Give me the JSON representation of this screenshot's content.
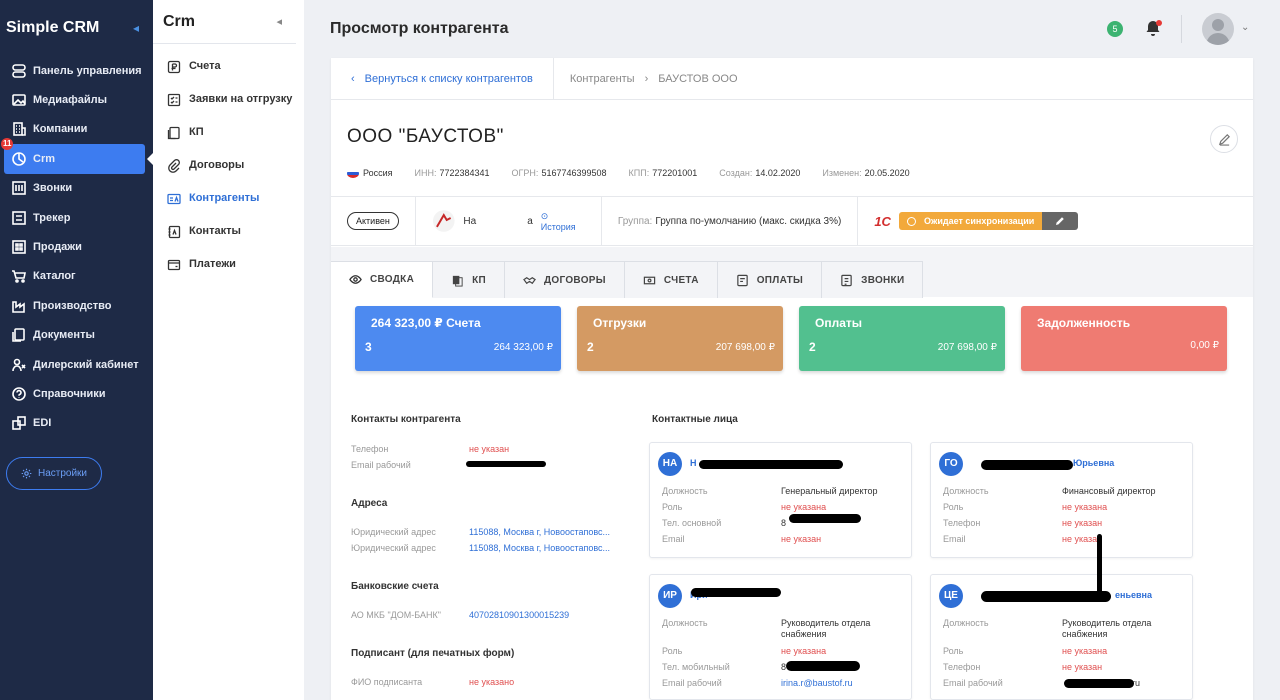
{
  "sidebar": {
    "brand": "Simple CRM",
    "items": [
      {
        "label": "Панель управления",
        "icon": "dashboard-icon"
      },
      {
        "label": "Медиафайлы",
        "icon": "media-icon"
      },
      {
        "label": "Компании",
        "icon": "building-icon"
      },
      {
        "label": "Crm",
        "icon": "crm-icon",
        "badge": "11",
        "active": true
      },
      {
        "label": "Звонки",
        "icon": "calls-icon"
      },
      {
        "label": "Трекер",
        "icon": "tracker-icon"
      },
      {
        "label": "Продажи",
        "icon": "sales-icon"
      },
      {
        "label": "Каталог",
        "icon": "cart-icon"
      },
      {
        "label": "Производство",
        "icon": "factory-icon"
      },
      {
        "label": "Документы",
        "icon": "documents-icon"
      },
      {
        "label": "Дилерский кабинет",
        "icon": "dealer-icon"
      },
      {
        "label": "Справочники",
        "icon": "help-icon"
      },
      {
        "label": "EDI",
        "icon": "edi-icon"
      }
    ],
    "settings_label": "Настройки"
  },
  "subpanel": {
    "title": "Crm",
    "items": [
      {
        "label": "Счета"
      },
      {
        "label": "Заявки на отгрузку"
      },
      {
        "label": "КП"
      },
      {
        "label": "Договоры"
      },
      {
        "label": "Контрагенты",
        "active": true
      },
      {
        "label": "Контакты"
      },
      {
        "label": "Платежи"
      }
    ]
  },
  "topbar": {
    "title": "Просмотр контрагента",
    "notif_count": "5"
  },
  "breadcrumbs": {
    "back": "Вернуться к списку контрагентов",
    "path": [
      "Контрагенты",
      "БАУСТОВ ООО"
    ]
  },
  "company": {
    "name": "ООО \"БАУСТОВ\"",
    "country": "Россия",
    "inn_label": "ИНН:",
    "inn": "7722384341",
    "ogrn_label": "ОГРН:",
    "ogrn": "5167746399508",
    "kpp_label": "КПП:",
    "kpp": "772201001",
    "created_label": "Создан:",
    "created": "14.02.2020",
    "changed_label": "Изменен:",
    "changed": "20.05.2020"
  },
  "status": {
    "state": "Активен",
    "manager": "Ha",
    "manager_suffix": "a",
    "history": "История",
    "group_label": "Группа:",
    "group": "Группа по-умолчанию (макс. скидка 3%)",
    "onec": "1С",
    "sync": "Ожидает синхронизации"
  },
  "tabs": [
    "СВОДКА",
    "КП",
    "ДОГОВОРЫ",
    "СЧЕТА",
    "ОПЛАТЫ",
    "ЗВОНКИ"
  ],
  "summary": [
    {
      "title": "264 323,00 ₽ Счета",
      "count": "3",
      "amount": "264 323,00 ₽",
      "color": "#4d8af0"
    },
    {
      "title": "Отгрузки",
      "count": "2",
      "amount": "207 698,00 ₽",
      "color": "#d49a63"
    },
    {
      "title": "Оплаты",
      "count": "2",
      "amount": "207 698,00 ₽",
      "color": "#52c08f"
    },
    {
      "title": "Задолженность",
      "count": "",
      "amount": "0,00 ₽",
      "color": "#ef7b72"
    }
  ],
  "contacts": {
    "title": "Контакты контрагента",
    "phone_label": "Телефон",
    "phone": "не указан",
    "email_label": "Email рабочий"
  },
  "addresses": {
    "title": "Адреса",
    "legal_label": "Юридический адрес",
    "legal": "115088, Москва г, Новоостаповс...",
    "legal2_label": "Юридический адрес",
    "legal2": "115088, Москва г, Новоостаповс..."
  },
  "bank": {
    "title": "Банковские счета",
    "name": "АО МКБ \"ДОМ-БАНК\"",
    "account": "40702810901300015239"
  },
  "signer": {
    "title": "Подписант (для печатных форм)",
    "fio_label": "ФИО подписанта",
    "fio": "не указано"
  },
  "persons_title": "Контактные лица",
  "persons": [
    {
      "initials": "НА",
      "name": "Н",
      "rows": [
        {
          "k": "Должность",
          "v": "Генеральный директор"
        },
        {
          "k": "Роль",
          "v": "не указана",
          "red": true
        },
        {
          "k": "Тел. основной",
          "v": "8"
        },
        {
          "k": "Email",
          "v": "не указан",
          "red": true
        }
      ]
    },
    {
      "initials": "ГО",
      "name": "Юрьевна",
      "rows": [
        {
          "k": "Должность",
          "v": "Финансовый директор"
        },
        {
          "k": "Роль",
          "v": "не указана",
          "red": true
        },
        {
          "k": "Телефон",
          "v": "не указан",
          "red": true
        },
        {
          "k": "Email",
          "v": "не указан",
          "red": true
        }
      ]
    },
    {
      "initials": "ИР",
      "name": "Ири",
      "rows": [
        {
          "k": "Должность",
          "v": "Руководитель отдела снабжения"
        },
        {
          "k": "Роль",
          "v": "не указана",
          "red": true
        },
        {
          "k": "Тел. мобильный",
          "v": "8"
        },
        {
          "k": "Email рабочий",
          "v": "irina.r@baustof.ru",
          "link": true
        }
      ]
    },
    {
      "initials": "ЦЕ",
      "name": "еньевна",
      "rows": [
        {
          "k": "Должность",
          "v": "Руководитель отдела снабжения"
        },
        {
          "k": "Роль",
          "v": "не указана",
          "red": true
        },
        {
          "k": "Телефон",
          "v": "не указан",
          "red": true
        },
        {
          "k": "Email рабочий",
          "v": "ru"
        }
      ]
    }
  ]
}
